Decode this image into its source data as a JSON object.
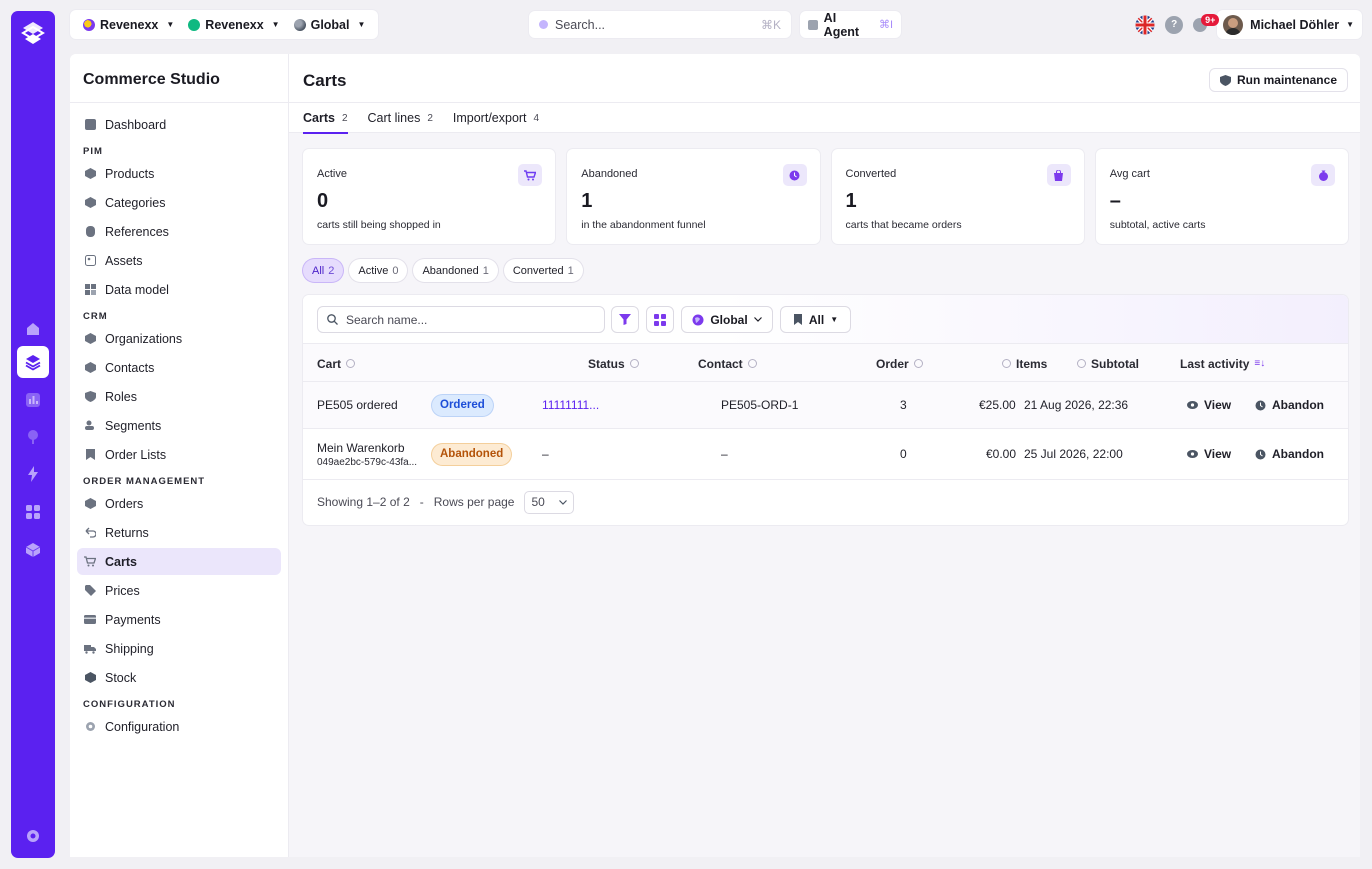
{
  "topbar": {
    "tenant1": "Revenexx",
    "tenant2": "Revenexx",
    "scope": "Global",
    "search_placeholder": "Search...",
    "search_shortcut": "⌘K",
    "ai_label": "AI Agent",
    "ai_shortcut": "⌘I",
    "notifications_badge": "9+",
    "user_name": "Michael Döhler"
  },
  "sidebar": {
    "title": "Commerce Studio",
    "dashboard": "Dashboard",
    "sections": [
      {
        "title": "PIM",
        "items": [
          "Products",
          "Categories",
          "References",
          "Assets",
          "Data model"
        ]
      },
      {
        "title": "CRM",
        "items": [
          "Organizations",
          "Contacts",
          "Roles",
          "Segments",
          "Order Lists"
        ]
      },
      {
        "title": "ORDER MANAGEMENT",
        "items": [
          "Orders",
          "Returns",
          "Carts",
          "Prices",
          "Payments",
          "Shipping",
          "Stock"
        ]
      },
      {
        "title": "CONFIGURATION",
        "items": [
          "Configuration"
        ]
      }
    ]
  },
  "page": {
    "title": "Carts",
    "run_maintenance": "Run maintenance",
    "tabs": [
      {
        "label": "Carts",
        "count": "2"
      },
      {
        "label": "Cart lines",
        "count": "2"
      },
      {
        "label": "Import/export",
        "count": "4"
      }
    ],
    "stats": [
      {
        "label": "Active",
        "value": "0",
        "sub": "carts still being shopped in"
      },
      {
        "label": "Abandoned",
        "value": "1",
        "sub": "in the abandonment funnel"
      },
      {
        "label": "Converted",
        "value": "1",
        "sub": "carts that became orders"
      },
      {
        "label": "Avg cart",
        "value": "–",
        "sub": "subtotal, active carts"
      }
    ],
    "chips": [
      {
        "label": "All",
        "count": "2"
      },
      {
        "label": "Active",
        "count": "0"
      },
      {
        "label": "Abandoned",
        "count": "1"
      },
      {
        "label": "Converted",
        "count": "1"
      }
    ],
    "table": {
      "search_placeholder": "Search name...",
      "scope_filter": "Global",
      "list_filter": "All",
      "columns": {
        "cart": "Cart",
        "status": "Status",
        "contact": "Contact",
        "order": "Order",
        "items": "Items",
        "subtotal": "Subtotal",
        "last_activity": "Last activity"
      },
      "rows": [
        {
          "cart": "PE505 ordered",
          "cart_sub": "",
          "status": "Ordered",
          "contact": "11111111...",
          "order": "PE505-ORD-1",
          "items": "3",
          "subtotal": "€25.00",
          "last_activity": "21 Aug 2026, 22:36",
          "view": "View",
          "abandon": "Abandon"
        },
        {
          "cart": "Mein Warenkorb",
          "cart_sub": "049ae2bc-579c-43fa...",
          "status": "Abandoned",
          "contact": "–",
          "order": "–",
          "items": "0",
          "subtotal": "€0.00",
          "last_activity": "25 Jul 2026, 22:00",
          "view": "View",
          "abandon": "Abandon"
        }
      ],
      "footer": {
        "showing": "Showing 1–2 of 2",
        "separator": "-",
        "rows_per_page": "Rows per page",
        "rows_value": "50"
      }
    }
  },
  "colors": {
    "accent": "#5b21f0",
    "ordered": "#1d4ed8",
    "abandoned": "#b45309"
  }
}
